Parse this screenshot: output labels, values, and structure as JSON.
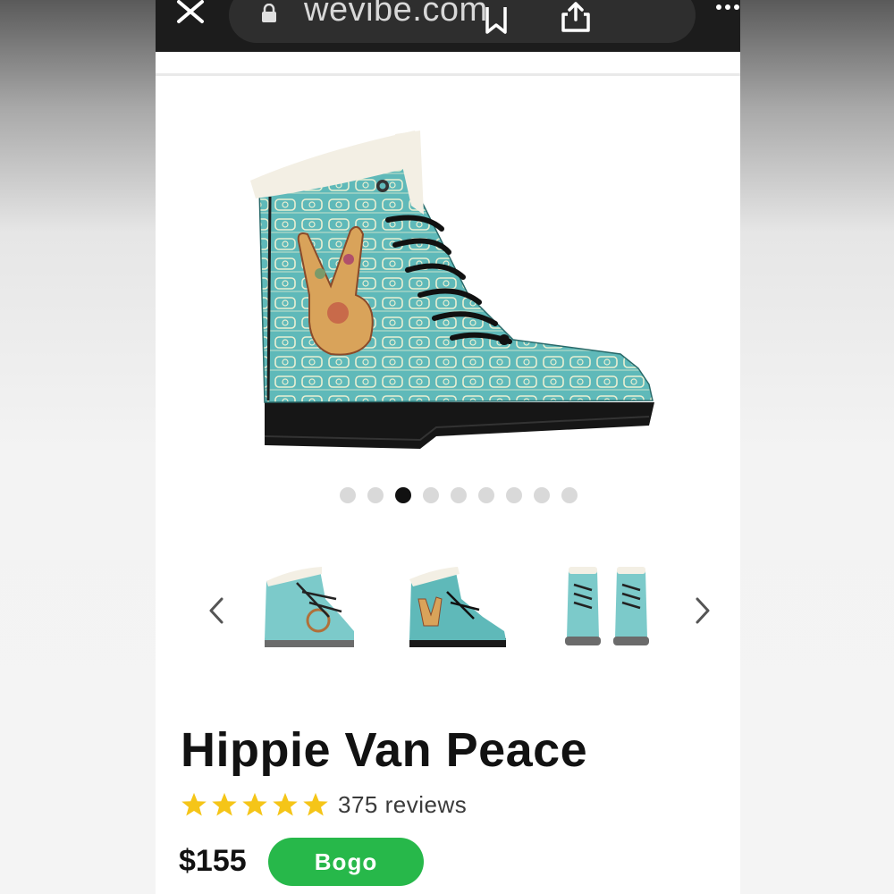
{
  "browser": {
    "url": "wevibe.com",
    "icons": [
      "close-icon",
      "lock-icon",
      "bookmark-icon",
      "share-icon",
      "more-icon"
    ]
  },
  "gallery": {
    "image_count": 9,
    "active_index": 2,
    "thumbnails": [
      "boot-side-view",
      "boot-peace-hand-view",
      "boot-front-pair-view"
    ],
    "nav_icons": [
      "chevron-left-icon",
      "chevron-right-icon"
    ]
  },
  "product": {
    "title": "Hippie Van Peace",
    "rating": 5,
    "review_count": "375 reviews",
    "price": "$155",
    "badge": "Bogo"
  },
  "colors": {
    "boot_teal": "#5fb9b9",
    "badge_green": "#27b84a",
    "star_gold": "#f5c518",
    "browser_bar": "#1c1c1c"
  }
}
